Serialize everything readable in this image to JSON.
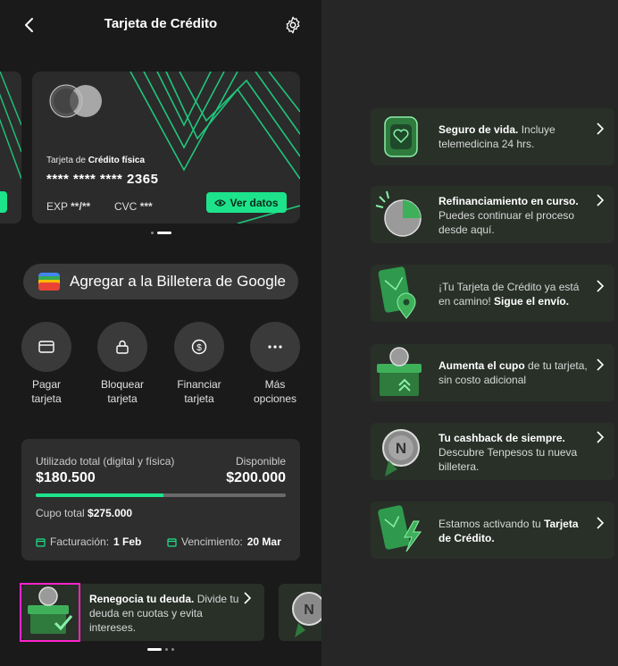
{
  "header": {
    "title": "Tarjeta de Crédito"
  },
  "card": {
    "type_prefix": "Tarjeta de ",
    "type_bold": "Crédito física",
    "number": "**** **** **** 2365",
    "exp_label": "EXP",
    "exp_value": "**/**",
    "cvc_label": "CVC",
    "cvc_value": "***",
    "ver_datos": "Ver datos"
  },
  "google_pay": {
    "label": "Agregar a la Billetera de Google"
  },
  "actions": [
    {
      "line1": "Pagar",
      "line2": "tarjeta",
      "icon": "card-icon"
    },
    {
      "line1": "Bloquear",
      "line2": "tarjeta",
      "icon": "lock-icon"
    },
    {
      "line1": "Financiar",
      "line2": "tarjeta",
      "icon": "dollar-icon"
    },
    {
      "line1": "Más",
      "line2": "opciones",
      "icon": "more-icon"
    }
  ],
  "usage": {
    "used_label": "Utilizado total (digital y física)",
    "used_value": "$180.500",
    "available_label": "Disponible",
    "available_value": "$200.000",
    "progress": 0.51,
    "cupo_label": "Cupo total",
    "cupo_value": "$275.000",
    "facturacion_label": "Facturación:",
    "facturacion_value": "1 Feb",
    "vencimiento_label": "Vencimiento:",
    "vencimiento_value": "20 Mar"
  },
  "left_promo": {
    "bold": "Renegocia tu deuda.",
    "rest": " Divide tu deuda en cuotas y evita intereses."
  },
  "promos": [
    {
      "bold": "Seguro de vida.",
      "rest": " Incluye telemedicina 24 hrs.",
      "icon": "watch-heart-icon"
    },
    {
      "bold": "Refinanciamiento en curso.",
      "rest": " Puedes continuar el proceso desde aquí.",
      "icon": "pie-chart-icon"
    },
    {
      "pre": "¡Tu Tarjeta de Crédito ya está en camino! ",
      "bold2": "Sigue el envío.",
      "icon": "card-location-icon"
    },
    {
      "bold": "Aumenta el cupo",
      "rest": " de tu tarjeta, sin costo adicional",
      "icon": "box-coin-icon"
    },
    {
      "bold": "Tu cashback de siempre.",
      "rest": " Descubre Tenpesos tu nueva billetera.",
      "icon": "coin-icon"
    },
    {
      "pre": "Estamos activando tu ",
      "bold2": "Tarjeta de Crédito.",
      "icon": "card-bolt-icon"
    }
  ],
  "colors": {
    "accent": "#1de38a",
    "card_bg": "#2b2b2b",
    "promo_bg": "#283028"
  }
}
